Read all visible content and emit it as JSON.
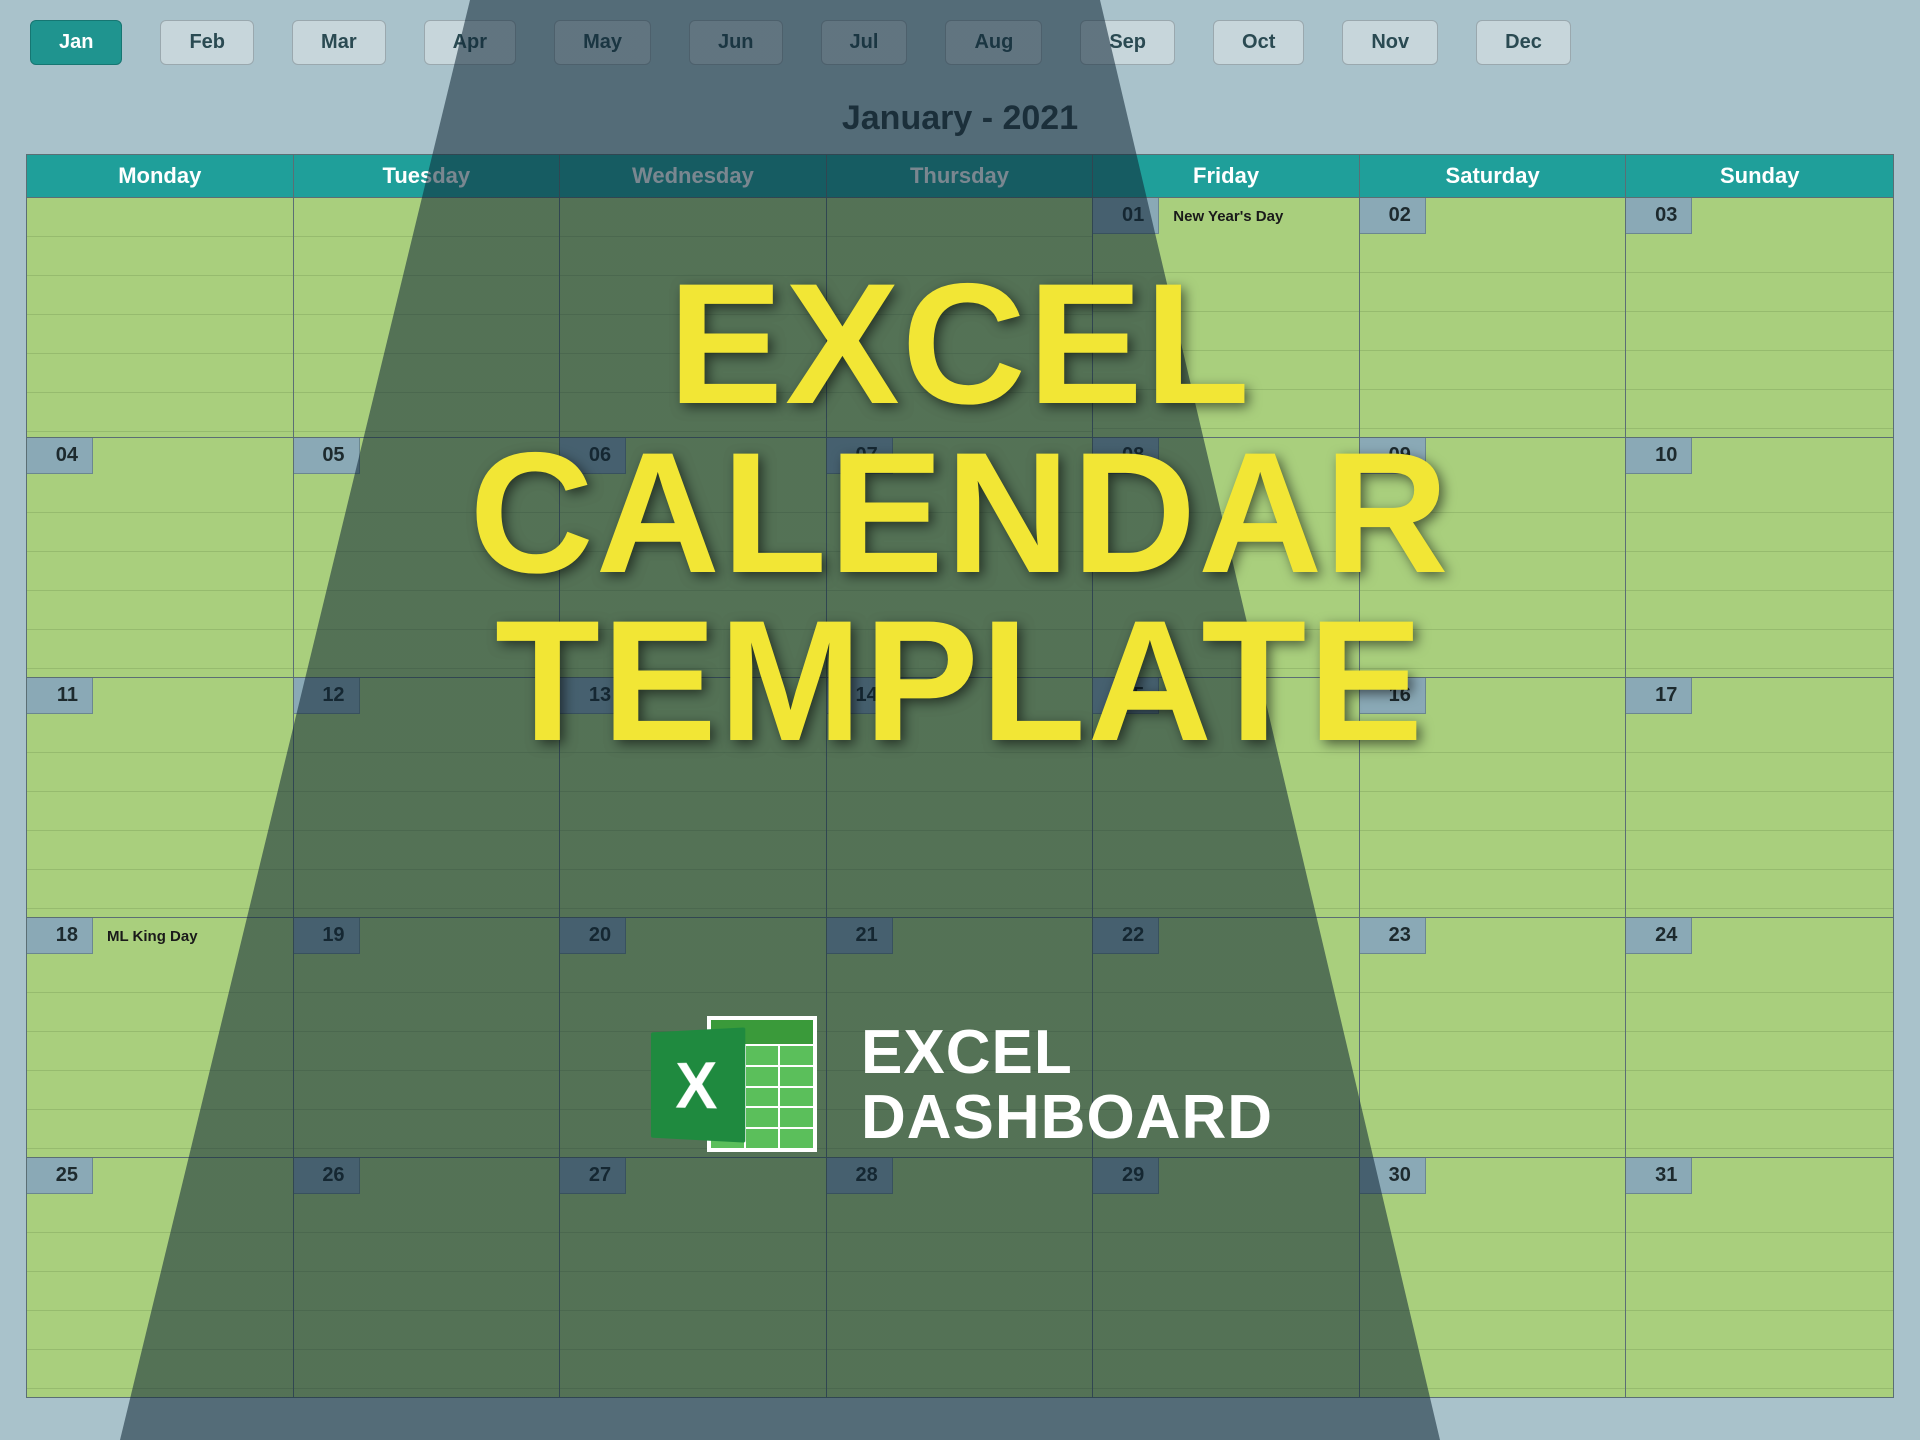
{
  "months": [
    "Jan",
    "Feb",
    "Mar",
    "Apr",
    "May",
    "Jun",
    "Jul",
    "Aug",
    "Sep",
    "Oct",
    "Nov",
    "Dec"
  ],
  "active_month_index": 0,
  "title": "January - 2021",
  "day_names": [
    "Monday",
    "Tuesday",
    "Wednesday",
    "Thursday",
    "Friday",
    "Saturday",
    "Sunday"
  ],
  "weeks": [
    [
      {
        "date": "",
        "event": ""
      },
      {
        "date": "",
        "event": ""
      },
      {
        "date": "",
        "event": ""
      },
      {
        "date": "",
        "event": ""
      },
      {
        "date": "01",
        "event": "New Year's Day"
      },
      {
        "date": "02",
        "event": ""
      },
      {
        "date": "03",
        "event": ""
      }
    ],
    [
      {
        "date": "04",
        "event": ""
      },
      {
        "date": "05",
        "event": ""
      },
      {
        "date": "06",
        "event": ""
      },
      {
        "date": "07",
        "event": ""
      },
      {
        "date": "08",
        "event": ""
      },
      {
        "date": "09",
        "event": ""
      },
      {
        "date": "10",
        "event": ""
      }
    ],
    [
      {
        "date": "11",
        "event": ""
      },
      {
        "date": "12",
        "event": ""
      },
      {
        "date": "13",
        "event": ""
      },
      {
        "date": "14",
        "event": ""
      },
      {
        "date": "15",
        "event": ""
      },
      {
        "date": "16",
        "event": ""
      },
      {
        "date": "17",
        "event": ""
      }
    ],
    [
      {
        "date": "18",
        "event": "ML King Day"
      },
      {
        "date": "19",
        "event": ""
      },
      {
        "date": "20",
        "event": ""
      },
      {
        "date": "21",
        "event": ""
      },
      {
        "date": "22",
        "event": ""
      },
      {
        "date": "23",
        "event": ""
      },
      {
        "date": "24",
        "event": ""
      }
    ],
    [
      {
        "date": "25",
        "event": ""
      },
      {
        "date": "26",
        "event": ""
      },
      {
        "date": "27",
        "event": ""
      },
      {
        "date": "28",
        "event": ""
      },
      {
        "date": "29",
        "event": ""
      },
      {
        "date": "30",
        "event": ""
      },
      {
        "date": "31",
        "event": ""
      }
    ]
  ],
  "overlay": {
    "line1": "EXCEL",
    "line2": "CALENDAR",
    "line3": "TEMPLATE",
    "icon_letter": "X",
    "brand_line1": "EXCEL",
    "brand_line2": "DASHBOARD"
  },
  "colors": {
    "accent": "#1f9f9a",
    "cell_bg": "#a9cf7d",
    "badge_bg": "#8aa9b6",
    "overlay_yellow": "#f2e635"
  }
}
